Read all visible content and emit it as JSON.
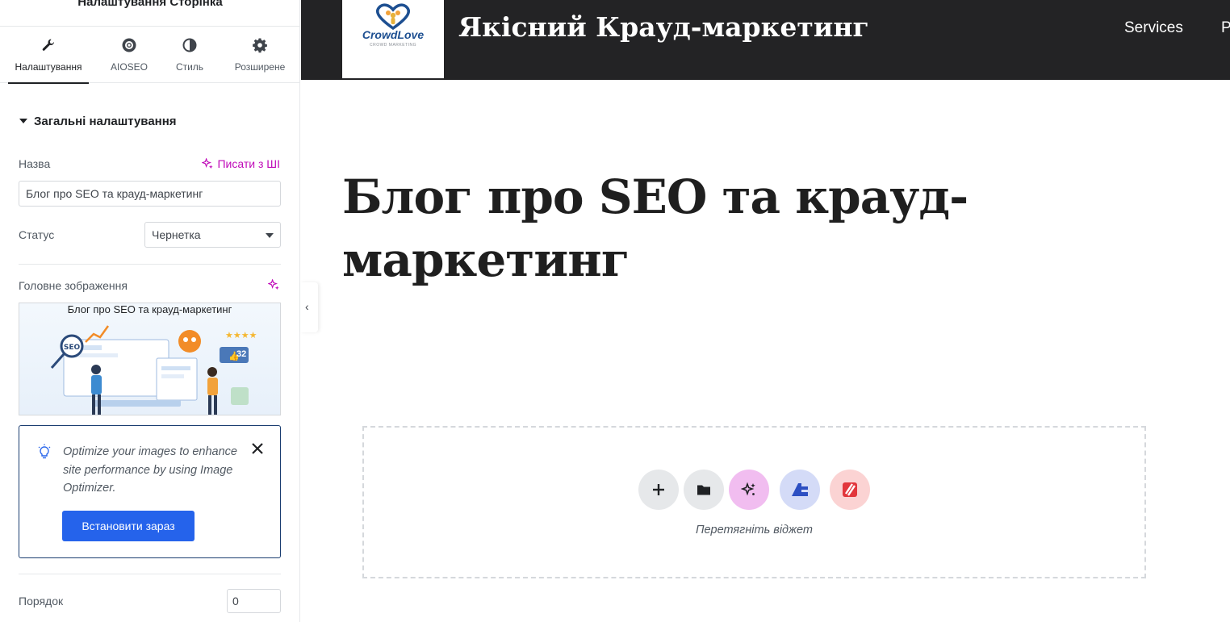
{
  "panel": {
    "title": "Налаштування Сторінка",
    "tabs": [
      {
        "label": "Налаштування",
        "icon": "wrench-icon"
      },
      {
        "label": "AIOSEO",
        "icon": "aioseo-icon"
      },
      {
        "label": "Стиль",
        "icon": "contrast-icon"
      },
      {
        "label": "Розширене",
        "icon": "gear-icon"
      }
    ],
    "section_title": "Загальні налаштування",
    "title_label": "Назва",
    "ai_write_label": "Писати з ШІ",
    "title_value": "Блог про SEO та крауд-маркетинг",
    "status_label": "Статус",
    "status_value": "Чернетка",
    "featured_image_label": "Головне зображення",
    "featured_image_caption": "Блог про SEO та крауд-маркетинг",
    "featured_image_badge": "32",
    "notice": {
      "text": "Optimize your images to enhance site performance by using Image Optimizer.",
      "button_label": "Встановити зараз"
    },
    "order_label": "Порядок",
    "order_value": "0"
  },
  "preview": {
    "logo_text": "CrowdLove",
    "logo_subtext": "CROWD MARKETING",
    "site_title": "Якісний Крауд-маркетинг",
    "nav": [
      "Services",
      "P"
    ],
    "post_title": "Блог про SEO та крауд-маркетинг",
    "drop_hint": "Перетягніть віджет"
  },
  "colors": {
    "header_bg": "#232325",
    "accent_ai": "#c00bb9",
    "button_primary": "#2563eb",
    "notice_border": "#1a3d70"
  }
}
